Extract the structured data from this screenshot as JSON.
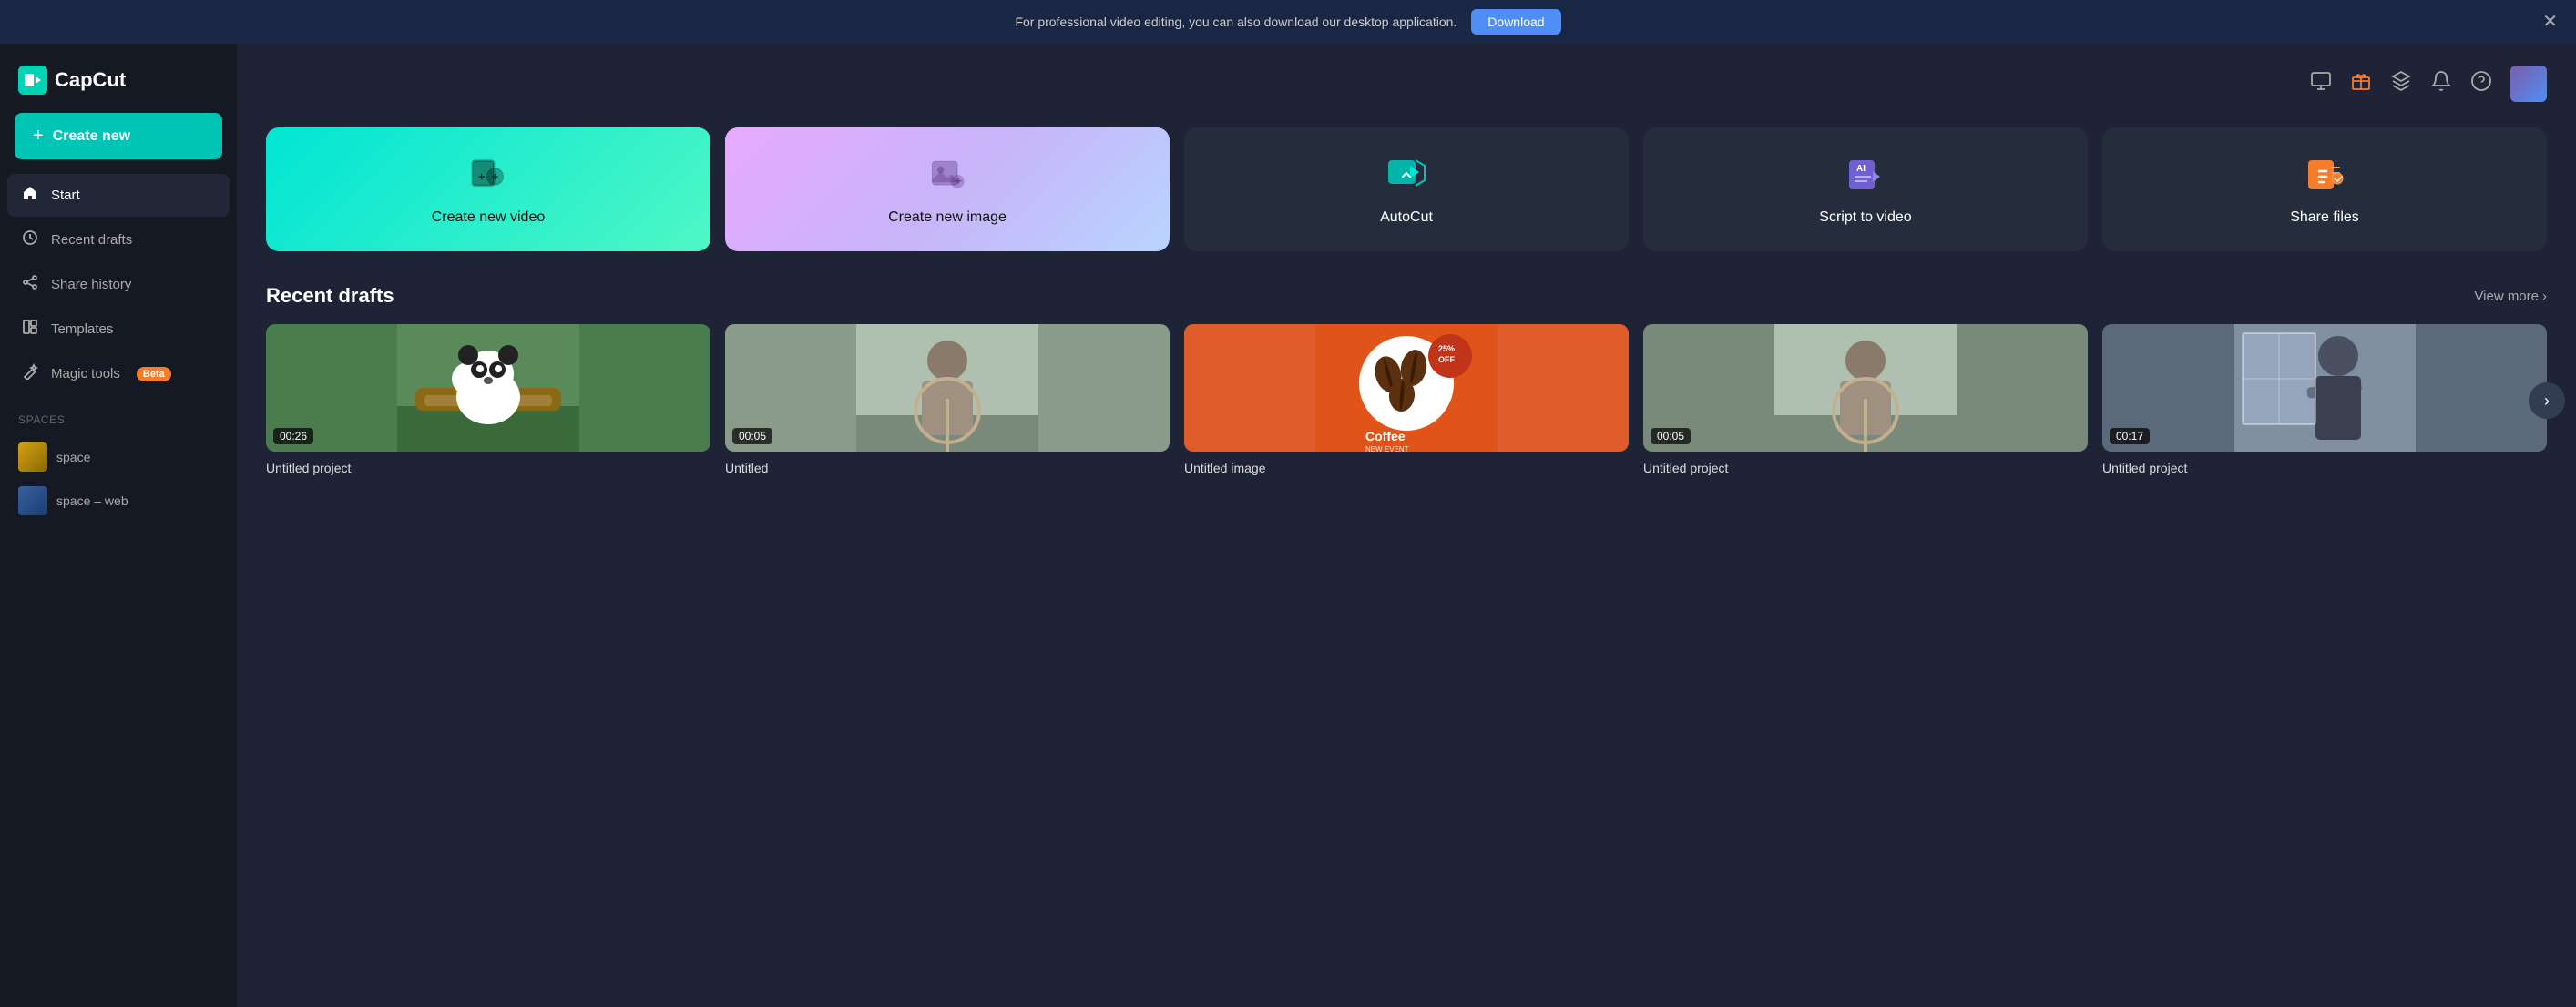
{
  "banner": {
    "text": "For professional video editing, you can also download our desktop application.",
    "download_label": "Download",
    "close_label": "✕"
  },
  "sidebar": {
    "logo_text": "CapCut",
    "create_new_label": "Create new",
    "nav_items": [
      {
        "id": "start",
        "label": "Start",
        "icon": "🏠",
        "active": true
      },
      {
        "id": "recent-drafts",
        "label": "Recent drafts",
        "icon": "🕐",
        "active": false
      },
      {
        "id": "share-history",
        "label": "Share history",
        "icon": "↗",
        "active": false
      },
      {
        "id": "templates",
        "label": "Templates",
        "icon": "⬜",
        "active": false
      }
    ],
    "magic_tools_label": "Magic tools",
    "beta_label": "Beta",
    "spaces_label": "Spaces",
    "spaces": [
      {
        "id": "space1",
        "label": "space",
        "color1": "#d4a017",
        "color2": "#8a6a00"
      },
      {
        "id": "space2",
        "label": "space – web",
        "color1": "#3a5fa0",
        "color2": "#1a3f70"
      }
    ]
  },
  "header": {
    "icons": [
      "monitor",
      "gift",
      "layers",
      "bell",
      "help"
    ]
  },
  "quick_actions": [
    {
      "id": "create-video",
      "label": "Create new video",
      "theme": "teal"
    },
    {
      "id": "create-image",
      "label": "Create new image",
      "theme": "purple"
    },
    {
      "id": "autocut",
      "label": "AutoCut",
      "theme": "dark"
    },
    {
      "id": "script-to-video",
      "label": "Script to video",
      "theme": "dark"
    },
    {
      "id": "share-files",
      "label": "Share files",
      "theme": "dark"
    }
  ],
  "recent_drafts": {
    "title": "Recent drafts",
    "view_more": "View more",
    "items": [
      {
        "id": "draft1",
        "title": "Untitled project",
        "duration": "00:26",
        "thumb": "panda"
      },
      {
        "id": "draft2",
        "title": "Untitled",
        "duration": "00:05",
        "thumb": "person"
      },
      {
        "id": "draft3",
        "title": "Untitled image",
        "duration": null,
        "thumb": "coffee"
      },
      {
        "id": "draft4",
        "title": "Untitled project",
        "duration": "00:05",
        "thumb": "person2"
      },
      {
        "id": "draft5",
        "title": "Untitled project",
        "duration": "00:17",
        "thumb": "person3"
      }
    ]
  }
}
